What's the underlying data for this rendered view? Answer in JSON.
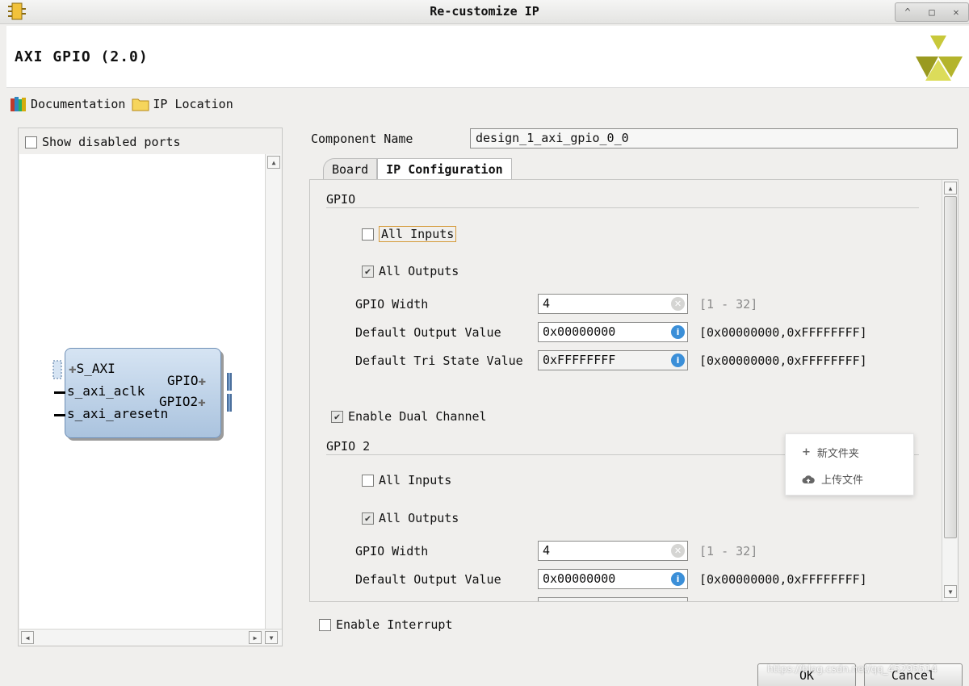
{
  "window": {
    "title": "Re-customize IP",
    "controls": [
      "^",
      "□",
      "✕"
    ]
  },
  "header": {
    "ip_title": "AXI GPIO (2.0)"
  },
  "toolbar": {
    "documentation": "Documentation",
    "ip_location": "IP Location"
  },
  "left_panel": {
    "show_disabled_ports": "Show disabled ports",
    "show_disabled_checked": false,
    "block": {
      "ports_left": [
        "S_AXI",
        "s_axi_aclk",
        "s_axi_aresetn"
      ],
      "ports_right": [
        "GPIO",
        "GPIO2"
      ]
    }
  },
  "component": {
    "label": "Component Name",
    "value": "design_1_axi_gpio_0_0"
  },
  "tabs": [
    {
      "label": "Board",
      "active": false
    },
    {
      "label": "IP Configuration",
      "active": true
    }
  ],
  "gpio": {
    "title": "GPIO",
    "all_inputs": {
      "label": "All Inputs",
      "checked": false
    },
    "all_outputs": {
      "label": "All Outputs",
      "checked": true
    },
    "width": {
      "label": "GPIO Width",
      "value": "4",
      "range": "[1 - 32]"
    },
    "default_output": {
      "label": "Default Output Value",
      "value": "0x00000000",
      "range": "[0x00000000,0xFFFFFFFF]"
    },
    "default_tri": {
      "label": "Default Tri State Value",
      "value": "0xFFFFFFFF",
      "range": "[0x00000000,0xFFFFFFFF]"
    }
  },
  "enable_dual_channel": {
    "label": "Enable Dual Channel",
    "checked": true
  },
  "gpio2": {
    "title": "GPIO 2",
    "all_inputs": {
      "label": "All Inputs",
      "checked": false
    },
    "all_outputs": {
      "label": "All Outputs",
      "checked": true
    },
    "width": {
      "label": "GPIO Width",
      "value": "4",
      "range": "[1 - 32]"
    },
    "default_output": {
      "label": "Default Output Value",
      "value": "0x00000000",
      "range": "[0x00000000,0xFFFFFFFF]"
    }
  },
  "enable_interrupt": {
    "label": "Enable Interrupt",
    "checked": false
  },
  "popup": {
    "items": [
      {
        "label": "新文件夹",
        "icon": "plus-icon"
      },
      {
        "label": "上传文件",
        "icon": "cloud-upload-icon"
      }
    ]
  },
  "buttons": {
    "ok": "OK",
    "cancel": "Cancel"
  },
  "watermark": "https://blog.csdn.net/qq_45295514"
}
